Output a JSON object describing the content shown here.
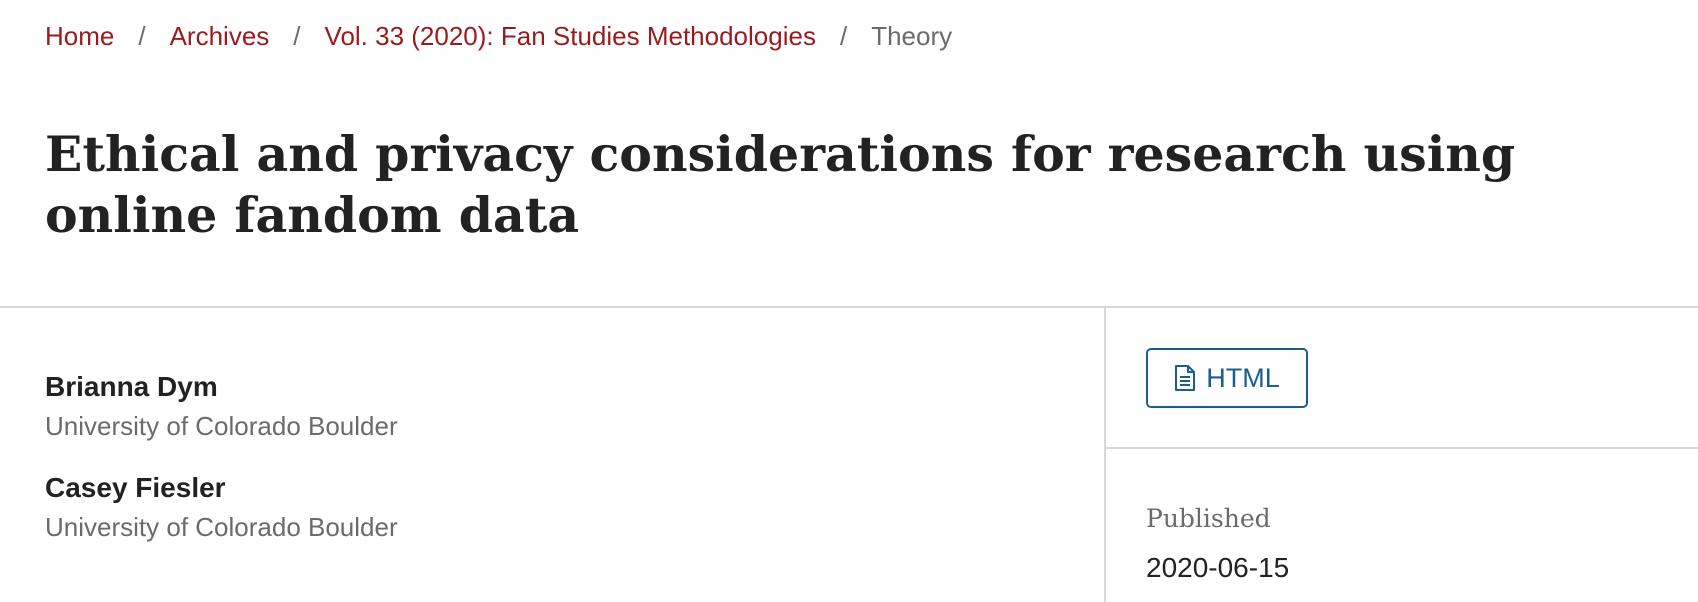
{
  "breadcrumb": {
    "items": [
      {
        "label": "Home"
      },
      {
        "label": "Archives"
      },
      {
        "label": "Vol. 33 (2020): Fan Studies Methodologies"
      }
    ],
    "separator": "/",
    "current": "Theory"
  },
  "article": {
    "title": "Ethical and privacy considerations for research using online fandom data",
    "authors": [
      {
        "name": "Brianna Dym",
        "affiliation": "University of Colorado Boulder"
      },
      {
        "name": "Casey Fiesler",
        "affiliation": "University of Colorado Boulder"
      }
    ]
  },
  "sidebar": {
    "galley_button": {
      "label": "HTML",
      "icon": "document-icon"
    },
    "published_label": "Published",
    "published_date": "2020-06-15"
  },
  "colors": {
    "link": "#9a1b1e",
    "button_accent": "#1a5e8a",
    "muted_text": "#6b6b6b"
  }
}
